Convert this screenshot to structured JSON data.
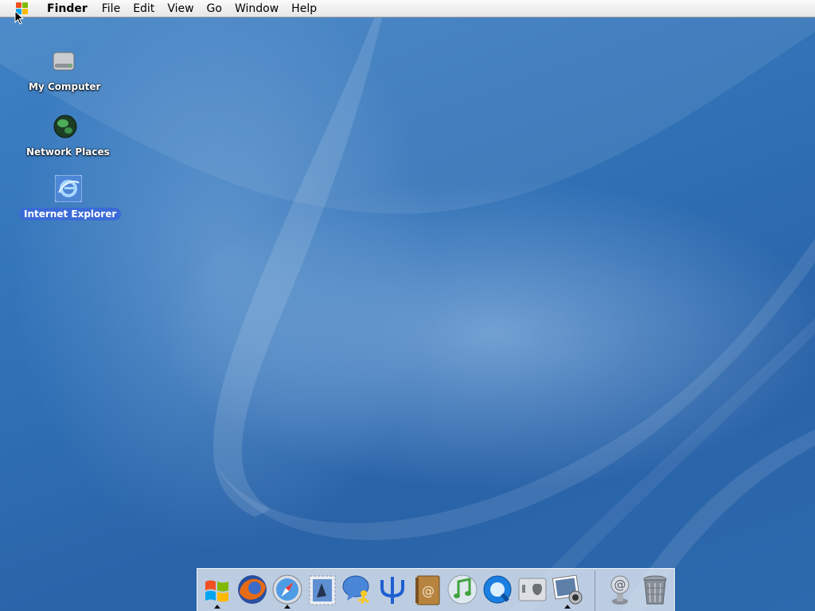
{
  "menubar": {
    "app_name": "Finder",
    "menus": [
      "File",
      "Edit",
      "View",
      "Go",
      "Window",
      "Help"
    ]
  },
  "desktop_icons": [
    {
      "label": "My Computer",
      "icon": "hard-drive-icon",
      "selected": false
    },
    {
      "label": "Network Places",
      "icon": "globe-icon",
      "selected": false
    },
    {
      "label": "Internet Explorer",
      "icon": "internet-explorer-icon",
      "selected": true
    }
  ],
  "dock": {
    "apps": [
      {
        "icon": "windows-start-icon",
        "running": true
      },
      {
        "icon": "firefox-icon",
        "running": false
      },
      {
        "icon": "safari-compass-icon",
        "running": true
      },
      {
        "icon": "mail-stamp-icon",
        "running": false
      },
      {
        "icon": "ichat-icon",
        "running": false
      },
      {
        "icon": "psi-icon",
        "running": false
      },
      {
        "icon": "address-book-icon",
        "running": false
      },
      {
        "icon": "itunes-icon",
        "running": false
      },
      {
        "icon": "quicktime-icon",
        "running": false
      },
      {
        "icon": "system-preferences-icon",
        "running": false
      },
      {
        "icon": "iphoto-icon",
        "running": true
      }
    ],
    "docs": [
      {
        "icon": "email-at-icon"
      },
      {
        "icon": "trash-icon"
      }
    ]
  },
  "colors": {
    "desktop": "#2f6fb4",
    "selection": "#3b6bd6"
  }
}
